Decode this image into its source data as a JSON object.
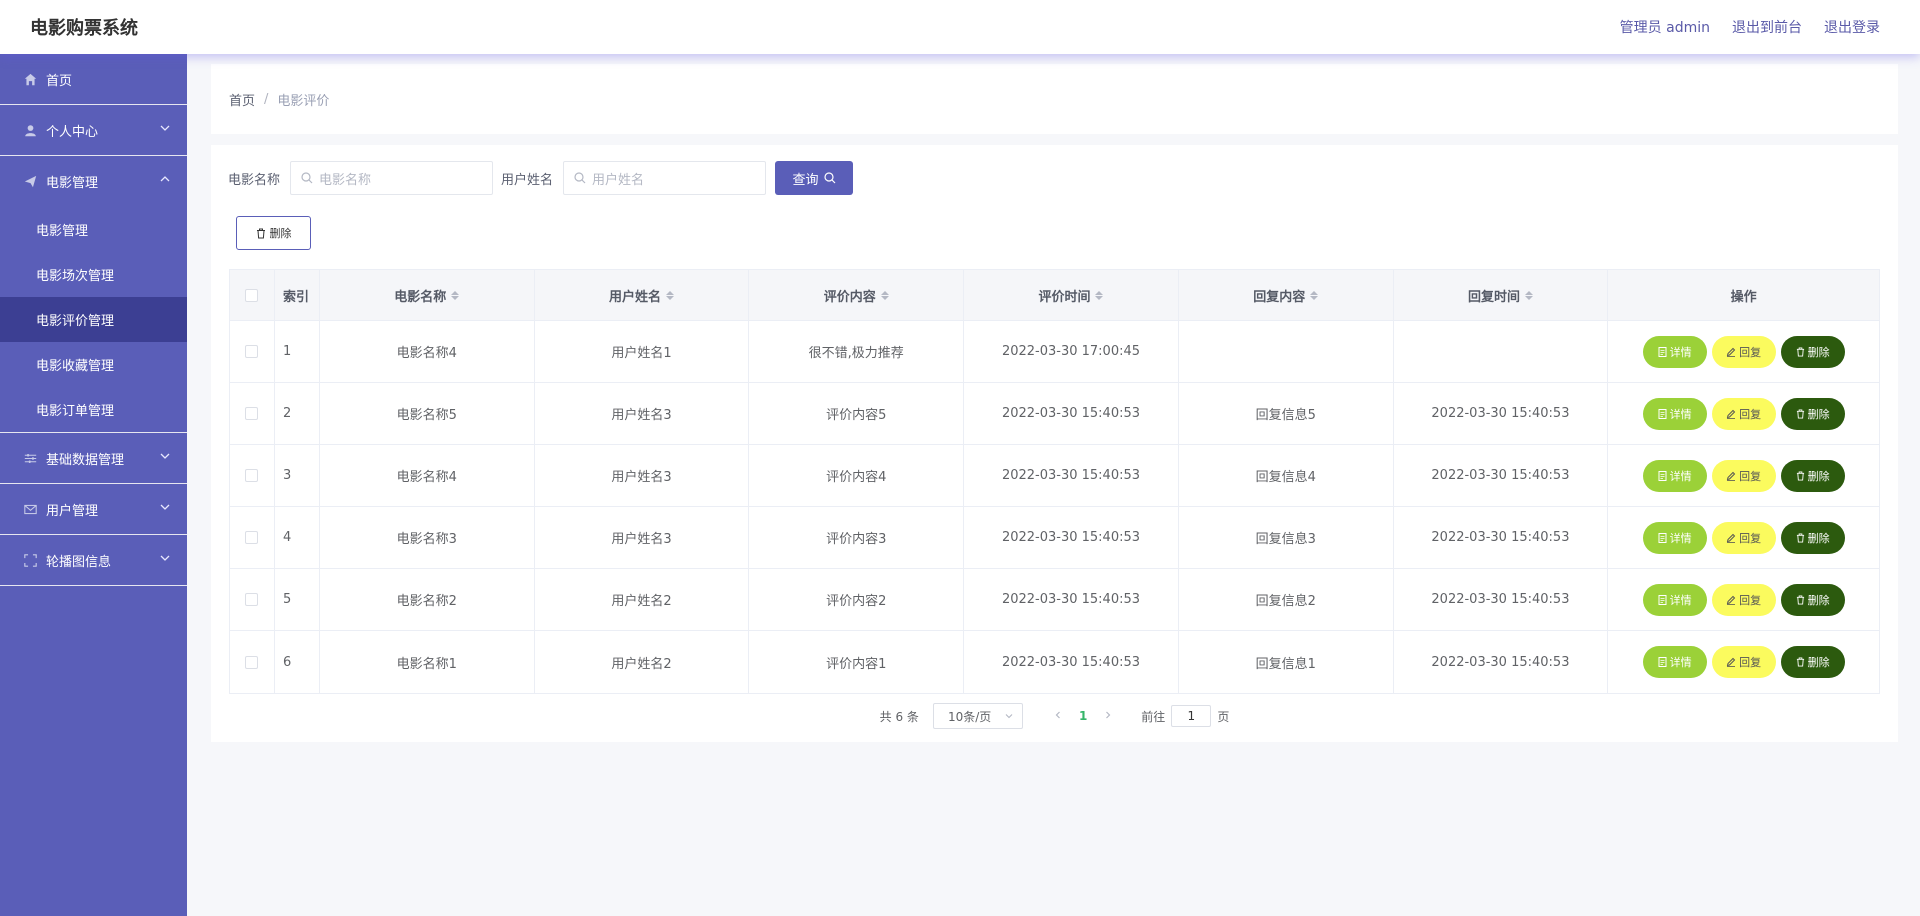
{
  "header": {
    "title": "电影购票系统",
    "user": "管理员 admin",
    "to_front": "退出到前台",
    "logout": "退出登录"
  },
  "sidebar": {
    "items": [
      {
        "label": "首页",
        "icon": "home-icon"
      },
      {
        "label": "个人中心",
        "icon": "user-icon"
      },
      {
        "label": "电影管理",
        "icon": "send-icon"
      },
      {
        "label": "基础数据管理",
        "icon": "sliders-icon"
      },
      {
        "label": "用户管理",
        "icon": "mail-icon"
      },
      {
        "label": "轮播图信息",
        "icon": "fullscreen-icon"
      }
    ],
    "submenu": [
      "电影管理",
      "电影场次管理",
      "电影评价管理",
      "电影收藏管理",
      "电影订单管理"
    ]
  },
  "breadcrumb": {
    "home": "首页",
    "separator": "/",
    "current": "电影评价"
  },
  "search": {
    "movie_label": "电影名称",
    "movie_placeholder": "电影名称",
    "user_label": "用户姓名",
    "user_placeholder": "用户姓名",
    "query_label": "查询"
  },
  "toolbar": {
    "delete_label": "删除"
  },
  "table": {
    "headers": [
      "索引",
      "电影名称",
      "用户姓名",
      "评价内容",
      "评价时间",
      "回复内容",
      "回复时间",
      "操作"
    ],
    "rows": [
      [
        "1",
        "电影名称4",
        "用户姓名1",
        "很不错,极力推荐",
        "2022-03-30 17:00:45",
        "",
        ""
      ],
      [
        "2",
        "电影名称5",
        "用户姓名3",
        "评价内容5",
        "2022-03-30 15:40:53",
        "回复信息5",
        "2022-03-30 15:40:53"
      ],
      [
        "3",
        "电影名称4",
        "用户姓名3",
        "评价内容4",
        "2022-03-30 15:40:53",
        "回复信息4",
        "2022-03-30 15:40:53"
      ],
      [
        "4",
        "电影名称3",
        "用户姓名3",
        "评价内容3",
        "2022-03-30 15:40:53",
        "回复信息3",
        "2022-03-30 15:40:53"
      ],
      [
        "5",
        "电影名称2",
        "用户姓名2",
        "评价内容2",
        "2022-03-30 15:40:53",
        "回复信息2",
        "2022-03-30 15:40:53"
      ],
      [
        "6",
        "电影名称1",
        "用户姓名2",
        "评价内容1",
        "2022-03-30 15:40:53",
        "回复信息1",
        "2022-03-30 15:40:53"
      ]
    ],
    "actions": {
      "detail": "详情",
      "reply": "回复",
      "delete": "删除"
    }
  },
  "pagination": {
    "total": "共 6 条",
    "page_size": "10条/页",
    "current_page": "1",
    "goto_label": "前往",
    "goto_value": "1",
    "page_suffix": "页"
  },
  "colors": {
    "sidebar": "#5a5eb8",
    "sidebar_active": "#3c3f93",
    "detail_button": "#9bd138",
    "reply_button": "#fbfb5e",
    "delete_button": "#2c5a0e"
  }
}
